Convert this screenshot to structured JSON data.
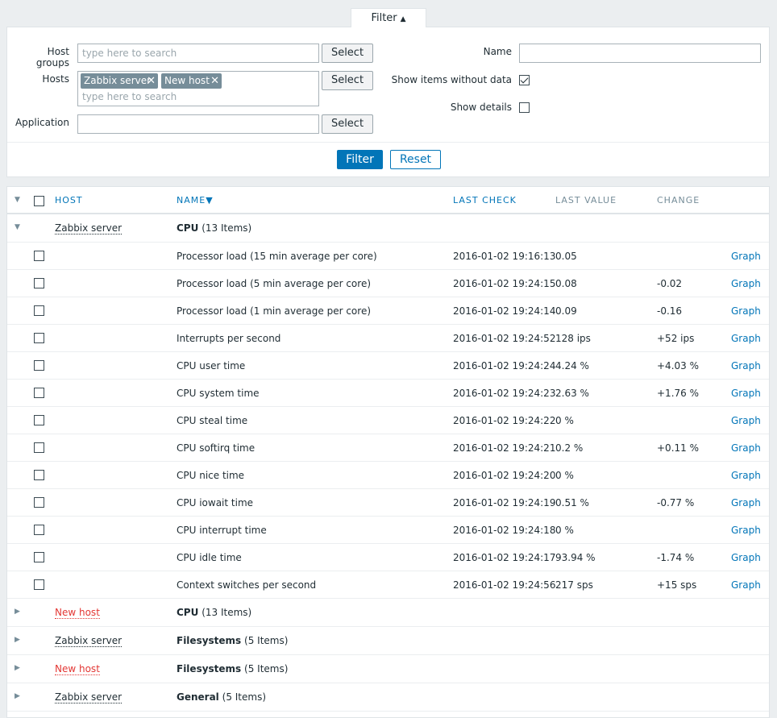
{
  "filter": {
    "tab_label": "Filter",
    "host_groups_label": "Host groups",
    "host_groups_placeholder": "type here to search",
    "hosts_label": "Hosts",
    "hosts_selected": [
      "Zabbix server",
      "New host"
    ],
    "hosts_placeholder": "type here to search",
    "application_label": "Application",
    "application_value": "",
    "select_label": "Select",
    "name_label": "Name",
    "name_value": "",
    "show_items_without_data_label": "Show items without data",
    "show_items_without_data_checked": true,
    "show_details_label": "Show details",
    "show_details_checked": false,
    "filter_button": "Filter",
    "reset_button": "Reset"
  },
  "table": {
    "headers": {
      "host": "HOST",
      "name": "NAME",
      "name_sort_arrow": "▼",
      "last_check": "LAST CHECK",
      "last_value": "LAST VALUE",
      "change": "CHANGE"
    },
    "expanded_group": {
      "host": "Zabbix server",
      "app": "CPU",
      "count": "(13 Items)"
    },
    "items": [
      {
        "name": "Processor load (15 min average per core)",
        "last_check": "2016-01-02 19:16:13",
        "last_value": "0.05",
        "change": "",
        "link": "Graph"
      },
      {
        "name": "Processor load (5 min average per core)",
        "last_check": "2016-01-02 19:24:15",
        "last_value": "0.08",
        "change": "-0.02",
        "link": "Graph"
      },
      {
        "name": "Processor load (1 min average per core)",
        "last_check": "2016-01-02 19:24:14",
        "last_value": "0.09",
        "change": "-0.16",
        "link": "Graph"
      },
      {
        "name": "Interrupts per second",
        "last_check": "2016-01-02 19:24:52",
        "last_value": "128 ips",
        "change": "+52 ips",
        "link": "Graph"
      },
      {
        "name": "CPU user time",
        "last_check": "2016-01-02 19:24:24",
        "last_value": "4.24 %",
        "change": "+4.03 %",
        "link": "Graph"
      },
      {
        "name": "CPU system time",
        "last_check": "2016-01-02 19:24:23",
        "last_value": "2.63 %",
        "change": "+1.76 %",
        "link": "Graph"
      },
      {
        "name": "CPU steal time",
        "last_check": "2016-01-02 19:24:22",
        "last_value": "0 %",
        "change": "",
        "link": "Graph"
      },
      {
        "name": "CPU softirq time",
        "last_check": "2016-01-02 19:24:21",
        "last_value": "0.2 %",
        "change": "+0.11 %",
        "link": "Graph"
      },
      {
        "name": "CPU nice time",
        "last_check": "2016-01-02 19:24:20",
        "last_value": "0 %",
        "change": "",
        "link": "Graph"
      },
      {
        "name": "CPU iowait time",
        "last_check": "2016-01-02 19:24:19",
        "last_value": "0.51 %",
        "change": "-0.77 %",
        "link": "Graph"
      },
      {
        "name": "CPU interrupt time",
        "last_check": "2016-01-02 19:24:18",
        "last_value": "0 %",
        "change": "",
        "link": "Graph"
      },
      {
        "name": "CPU idle time",
        "last_check": "2016-01-02 19:24:17",
        "last_value": "93.94 %",
        "change": "-1.74 %",
        "link": "Graph"
      },
      {
        "name": "Context switches per second",
        "last_check": "2016-01-02 19:24:56",
        "last_value": "217 sps",
        "change": "+15 sps",
        "link": "Graph"
      }
    ],
    "collapsed_groups": [
      {
        "host": "New host",
        "app": "CPU",
        "count": "(13 Items)",
        "host_disabled": true
      },
      {
        "host": "Zabbix server",
        "app": "Filesystems",
        "count": "(5 Items)",
        "host_disabled": false
      },
      {
        "host": "New host",
        "app": "Filesystems",
        "count": "(5 Items)",
        "host_disabled": true
      },
      {
        "host": "Zabbix server",
        "app": "General",
        "count": "(5 Items)",
        "host_disabled": false
      }
    ]
  },
  "colors": {
    "accent": "#0275b8",
    "disabled_host": "#e33734",
    "background": "#ebeef0"
  }
}
